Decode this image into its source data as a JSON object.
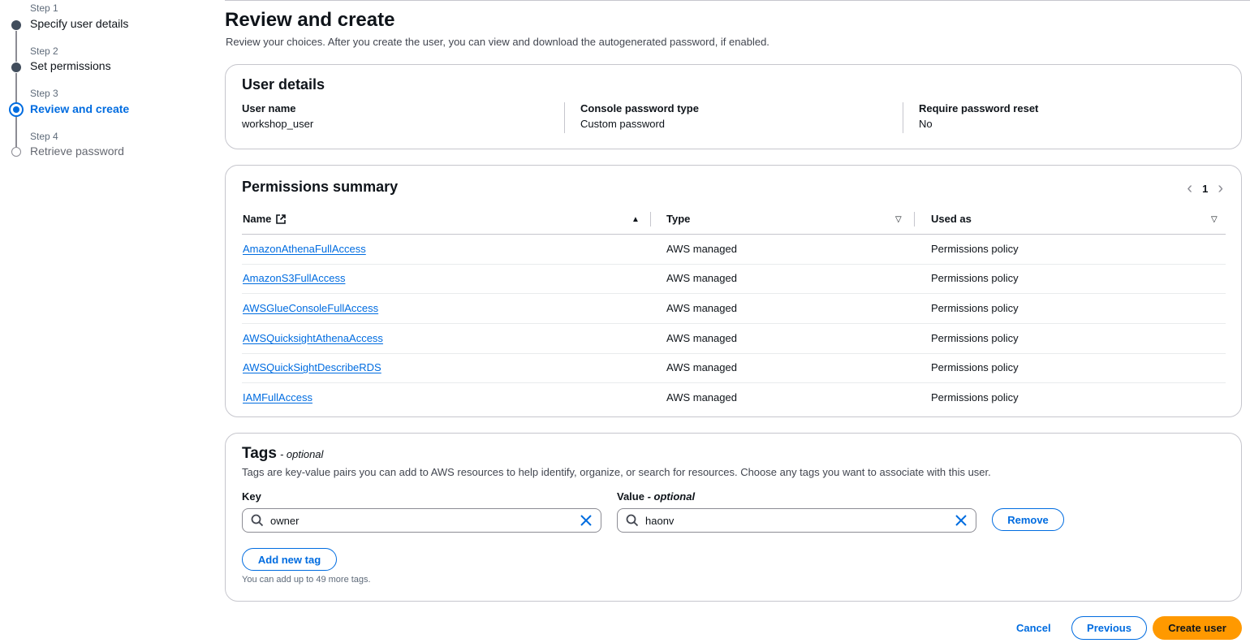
{
  "steps": [
    {
      "number": "Step 1",
      "title": "Specify user details",
      "state": "done"
    },
    {
      "number": "Step 2",
      "title": "Set permissions",
      "state": "done"
    },
    {
      "number": "Step 3",
      "title": "Review and create",
      "state": "current"
    },
    {
      "number": "Step 4",
      "title": "Retrieve password",
      "state": "upcoming"
    }
  ],
  "page": {
    "title": "Review and create",
    "description": "Review your choices. After you create the user, you can view and download the autogenerated password, if enabled."
  },
  "user_details": {
    "title": "User details",
    "fields": [
      {
        "label": "User name",
        "value": "workshop_user"
      },
      {
        "label": "Console password type",
        "value": "Custom password"
      },
      {
        "label": "Require password reset",
        "value": "No"
      }
    ]
  },
  "permissions": {
    "title": "Permissions summary",
    "page_number": "1",
    "columns": [
      "Name",
      "Type",
      "Used as"
    ],
    "rows": [
      {
        "name": "AmazonAthenaFullAccess",
        "type": "AWS managed",
        "used_as": "Permissions policy"
      },
      {
        "name": "AmazonS3FullAccess",
        "type": "AWS managed",
        "used_as": "Permissions policy"
      },
      {
        "name": "AWSGlueConsoleFullAccess",
        "type": "AWS managed",
        "used_as": "Permissions policy"
      },
      {
        "name": "AWSQuicksightAthenaAccess",
        "type": "AWS managed",
        "used_as": "Permissions policy"
      },
      {
        "name": "AWSQuickSightDescribeRDS",
        "type": "AWS managed",
        "used_as": "Permissions policy"
      },
      {
        "name": "IAMFullAccess",
        "type": "AWS managed",
        "used_as": "Permissions policy"
      }
    ]
  },
  "tags": {
    "title": "Tags",
    "title_optional": "- optional",
    "description": "Tags are key-value pairs you can add to AWS resources to help identify, organize, or search for resources. Choose any tags you want to associate with this user.",
    "key_label": "Key",
    "value_label": "Value",
    "value_optional": "- optional",
    "key_value": "owner",
    "value_value": "haonv",
    "remove_label": "Remove",
    "add_label": "Add new tag",
    "hint": "You can add up to 49 more tags."
  },
  "footer": {
    "cancel": "Cancel",
    "previous": "Previous",
    "create": "Create user"
  },
  "icons": {
    "search": "search-icon",
    "clear": "close-icon",
    "external": "external-link-icon",
    "sort_asc": "sort-ascending-icon",
    "sort_desc": "sort-descending-icon"
  },
  "colors": {
    "accent": "#006ce0",
    "primary_button": "#ff9900",
    "border": "#c6c6cd"
  }
}
